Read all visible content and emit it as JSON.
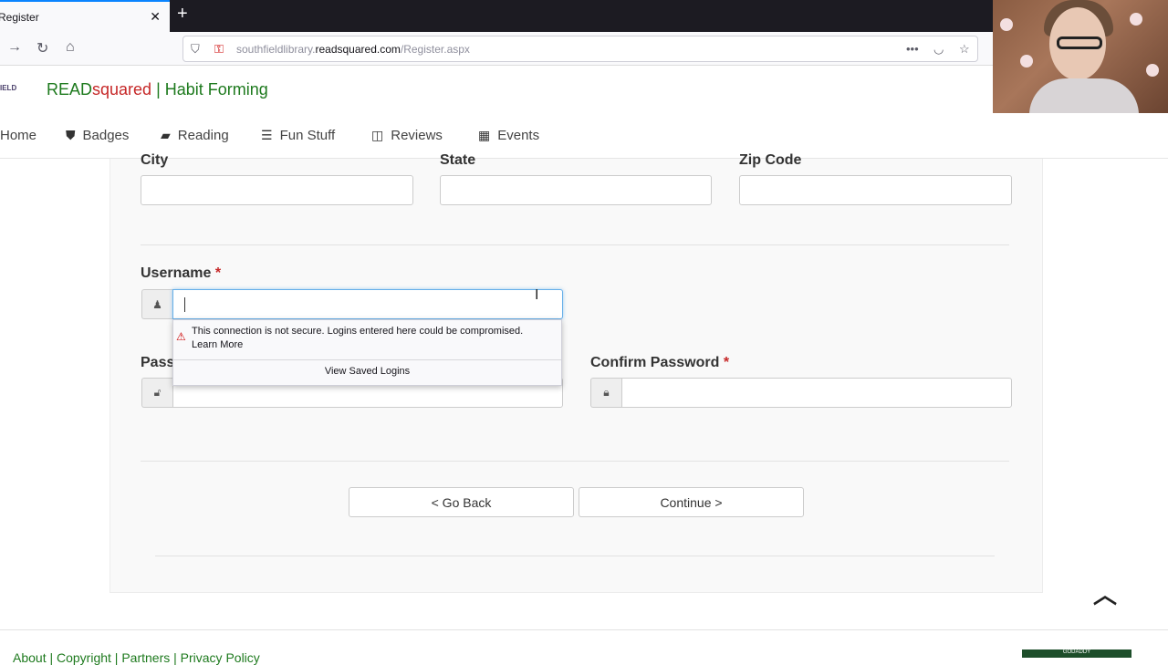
{
  "browser": {
    "tab_title": "Register",
    "url_domain_prefix": "southfieldlibrary.",
    "url_domain": "readsquared.com",
    "url_path": "/Register.aspx"
  },
  "site": {
    "logo_text": "IELD",
    "brand_read": "READ",
    "brand_squared": "squared",
    "brand_sep": " | ",
    "brand_tagline": "Habit Forming"
  },
  "menu": {
    "items": [
      {
        "label": "Home",
        "icon": "home-icon"
      },
      {
        "label": "Badges",
        "icon": "shield-icon"
      },
      {
        "label": "Reading",
        "icon": "book-icon"
      },
      {
        "label": "Fun Stuff",
        "icon": "list-icon"
      },
      {
        "label": "Reviews",
        "icon": "open-book-icon"
      },
      {
        "label": "Events",
        "icon": "calendar-icon"
      }
    ]
  },
  "form": {
    "city_label": "City",
    "state_label": "State",
    "zip_label": "Zip Code",
    "username_label": "Username",
    "password_label": "Pass",
    "confirm_password_label": "Confirm Password",
    "required_marker": "*"
  },
  "login_popup": {
    "message": "This connection is not secure. Logins entered here could be compromised.",
    "learn_more": "Learn More",
    "view_saved": "View Saved Logins"
  },
  "buttons": {
    "back": "< Go Back",
    "continue": "Continue >"
  },
  "footer": {
    "links_text": "About  |  Copyright  |  Partners  |  Privacy Policy",
    "badge_text": "GODADDY"
  }
}
